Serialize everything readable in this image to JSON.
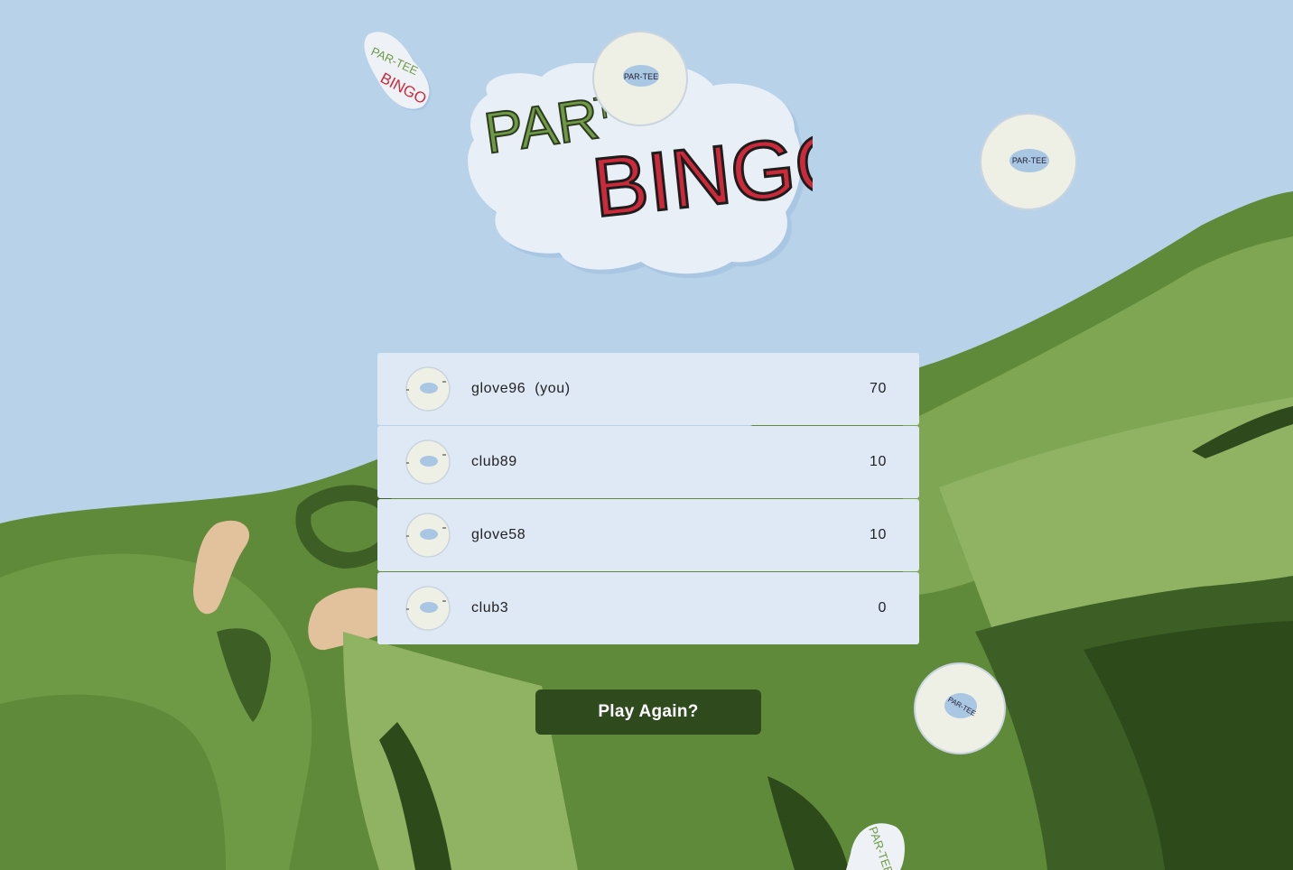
{
  "logo": {
    "line1": "PAR",
    "line1b": "TEE",
    "line2": "BINGO",
    "ball_text": "PAR-TEE"
  },
  "sticker": {
    "line1": "PAR-TEE",
    "line2": "BINGO"
  },
  "leaderboard": {
    "players": [
      {
        "name": "glove96",
        "you_label": "(you)",
        "score": "70",
        "avatar": "golf-ball-icon"
      },
      {
        "name": "club89",
        "you_label": "",
        "score": "10",
        "avatar": "golf-ball-icon"
      },
      {
        "name": "glove58",
        "you_label": "",
        "score": "10",
        "avatar": "golf-ball-icon"
      },
      {
        "name": "club3",
        "you_label": "",
        "score": "0",
        "avatar": "golf-ball-icon"
      }
    ]
  },
  "actions": {
    "play_again_label": "Play Again?"
  },
  "colors": {
    "sky": "#b8d3e9",
    "grass_light": "#8fb263",
    "grass_mid": "#5f8a3a",
    "grass_dark": "#3d5f25",
    "sand": "#e2c29c",
    "logo_green": "#6f9a45",
    "logo_red": "#cc2a3a",
    "button": "#2f4a1d",
    "row_bg": "#dfe9f5"
  }
}
